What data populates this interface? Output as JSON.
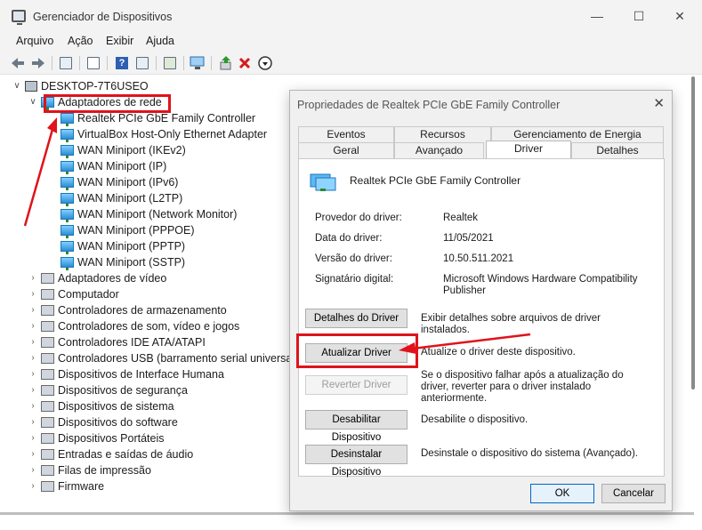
{
  "window": {
    "title": "Gerenciador de Dispositivos",
    "controls": [
      "minimize-icon",
      "maximize-icon",
      "close-icon"
    ]
  },
  "menu": [
    "Arquivo",
    "Ação",
    "Exibir",
    "Ajuda"
  ],
  "tree": {
    "root": "DESKTOP-7T6USEO",
    "network_adapters": {
      "label": "Adaptadores de rede",
      "children": [
        "Realtek PCIe GbE Family Controller",
        "VirtualBox Host-Only Ethernet Adapter",
        "WAN Miniport (IKEv2)",
        "WAN Miniport (IP)",
        "WAN Miniport (IPv6)",
        "WAN Miniport (L2TP)",
        "WAN Miniport (Network Monitor)",
        "WAN Miniport (PPPOE)",
        "WAN Miniport (PPTP)",
        "WAN Miniport (SSTP)"
      ]
    },
    "categories": [
      "Adaptadores de vídeo",
      "Computador",
      "Controladores de armazenamento",
      "Controladores de som, vídeo e jogos",
      "Controladores IDE ATA/ATAPI",
      "Controladores USB (barramento serial universal)",
      "Dispositivos de Interface Humana",
      "Dispositivos de segurança",
      "Dispositivos de sistema",
      "Dispositivos do software",
      "Dispositivos Portáteis",
      "Entradas e saídas de áudio",
      "Filas de impressão",
      "Firmware"
    ]
  },
  "dialog": {
    "title": "Propriedades de Realtek PCIe GbE Family Controller",
    "tabs_top": [
      "Eventos",
      "Recursos",
      "Gerenciamento de Energia"
    ],
    "tabs_bottom": [
      "Geral",
      "Avançado",
      "Driver",
      "Detalhes"
    ],
    "active_tab": "Driver",
    "device_name": "Realtek PCIe GbE Family Controller",
    "fields": [
      {
        "label": "Provedor do driver:",
        "value": "Realtek"
      },
      {
        "label": "Data do driver:",
        "value": "11/05/2021"
      },
      {
        "label": "Versão do driver:",
        "value": "10.50.511.2021"
      },
      {
        "label": "Signatário digital:",
        "value": "Microsoft Windows Hardware Compatibility Publisher"
      }
    ],
    "actions": [
      {
        "button": "Detalhes do Driver",
        "desc": "Exibir detalhes sobre arquivos de driver instalados."
      },
      {
        "button": "Atualizar Driver",
        "desc": "Atualize o driver deste dispositivo."
      },
      {
        "button": "Reverter Driver",
        "desc": "Se o dispositivo falhar após a atualização do driver, reverter para o driver instalado anteriormente."
      },
      {
        "button": "Desabilitar Dispositivo",
        "desc": "Desabilite o dispositivo."
      },
      {
        "button": "Desinstalar Dispositivo",
        "desc": "Desinstale o dispositivo do sistema (Avançado)."
      }
    ],
    "ok": "OK",
    "cancel": "Cancelar"
  },
  "colors": {
    "highlight": "#e0121b",
    "accent": "#1b75bb"
  }
}
